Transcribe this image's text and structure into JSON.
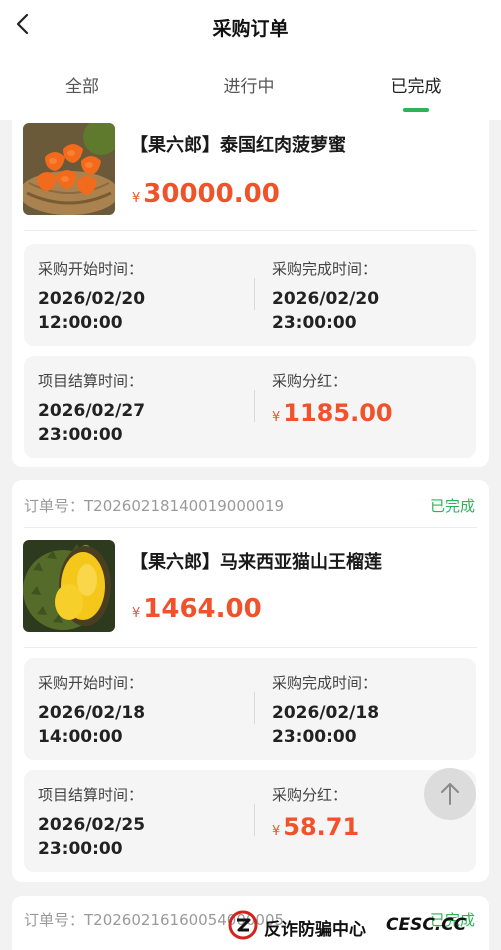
{
  "header": {
    "title": "采购订单",
    "tabs": [
      {
        "label": "全部",
        "active": false
      },
      {
        "label": "进行中",
        "active": false
      },
      {
        "label": "已完成",
        "active": true
      }
    ]
  },
  "labels": {
    "order_no_prefix": "订单号：",
    "start_time": "采购开始时间：",
    "complete_time": "采购完成时间：",
    "settle_time": "项目结算时间：",
    "dividend": "采购分红：",
    "currency": "¥"
  },
  "orders": [
    {
      "product_name": "【果六郎】泰国红肉菠萝蜜",
      "price": "30000.00",
      "start_date": "2026/02/20",
      "start_clock": "12:00:00",
      "complete_date": "2026/02/20",
      "complete_clock": "23:00:00",
      "settle_date": "2026/02/27",
      "settle_clock": "23:00:00",
      "dividend": "1185.00",
      "thumbnail_icon": "jackfruit-image"
    },
    {
      "order_no": "T20260218140019000019",
      "status": "已完成",
      "product_name": "【果六郎】马来西亚猫山王榴莲",
      "price": "1464.00",
      "start_date": "2026/02/18",
      "start_clock": "14:00:00",
      "complete_date": "2026/02/18",
      "complete_clock": "23:00:00",
      "settle_date": "2026/02/25",
      "settle_clock": "23:00:00",
      "dividend": "58.71",
      "thumbnail_icon": "durian-image"
    },
    {
      "order_no": "T20260216160054000005",
      "status": "已完成"
    }
  ],
  "watermark": {
    "text": "反诈防骗中心",
    "domain": "CESC.CC"
  },
  "colors": {
    "accent_green": "#2cb457",
    "price_orange": "#f0522a"
  }
}
